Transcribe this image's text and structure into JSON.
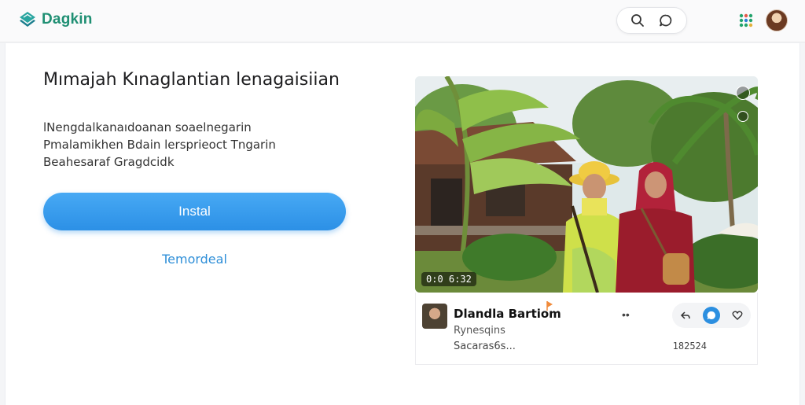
{
  "app": {
    "name": "Dagkin"
  },
  "colors": {
    "brand": "#1f8f73",
    "accent": "#2c90e6",
    "link": "#2f8fd8"
  },
  "topbar": {
    "icons": [
      "search-icon",
      "chat-bubble-icon",
      "apps-grid-icon",
      "user-avatar"
    ]
  },
  "main": {
    "title": "Mımajah Kınaglantian lenagaisiian",
    "description": [
      "lNengdalkanaıdoanan soaelnegarin",
      "Pmalamikhen Bdain lersprieoct Tngarin",
      "Beahesaraf Gragdcidk"
    ],
    "install_label": "Instal",
    "secondary_label": "Temordeal"
  },
  "media": {
    "badge": "0:0 6:32",
    "icons": [
      "expand-icon",
      "options-dot-icon"
    ]
  },
  "post": {
    "name": "Dlandla Bartiom",
    "subtitle": "Rynesqins",
    "meta": "Sacaras6s...",
    "more": "••",
    "count": "182524",
    "actions": [
      "reply-icon",
      "comment-icon",
      "heart-icon"
    ]
  }
}
